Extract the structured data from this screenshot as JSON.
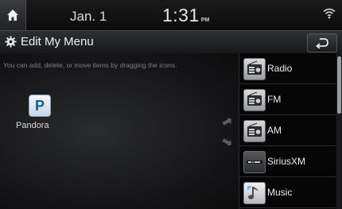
{
  "status_bar": {
    "date": "Jan.  1",
    "time": "1:31",
    "ampm": "PM"
  },
  "title_bar": {
    "title": "Edit My Menu"
  },
  "instruction": "You can add, delete, or move items by dragging the icons.",
  "workspace_items": [
    {
      "label": "Pandora",
      "icon": "pandora-icon",
      "glyph": "P"
    }
  ],
  "menu_items": [
    {
      "label": "Radio",
      "icon": "radio-icon"
    },
    {
      "label": "FM",
      "icon": "radio-icon"
    },
    {
      "label": "AM",
      "icon": "radio-icon"
    },
    {
      "label": "SiriusXM",
      "icon": "siriusxm-icon"
    },
    {
      "label": "Music",
      "icon": "music-icon"
    }
  ],
  "colors": {
    "background": "#0b0b0c",
    "text": "#ececec",
    "instruction_text": "#7c7d80",
    "pandora_blue": "#1a5a92"
  }
}
